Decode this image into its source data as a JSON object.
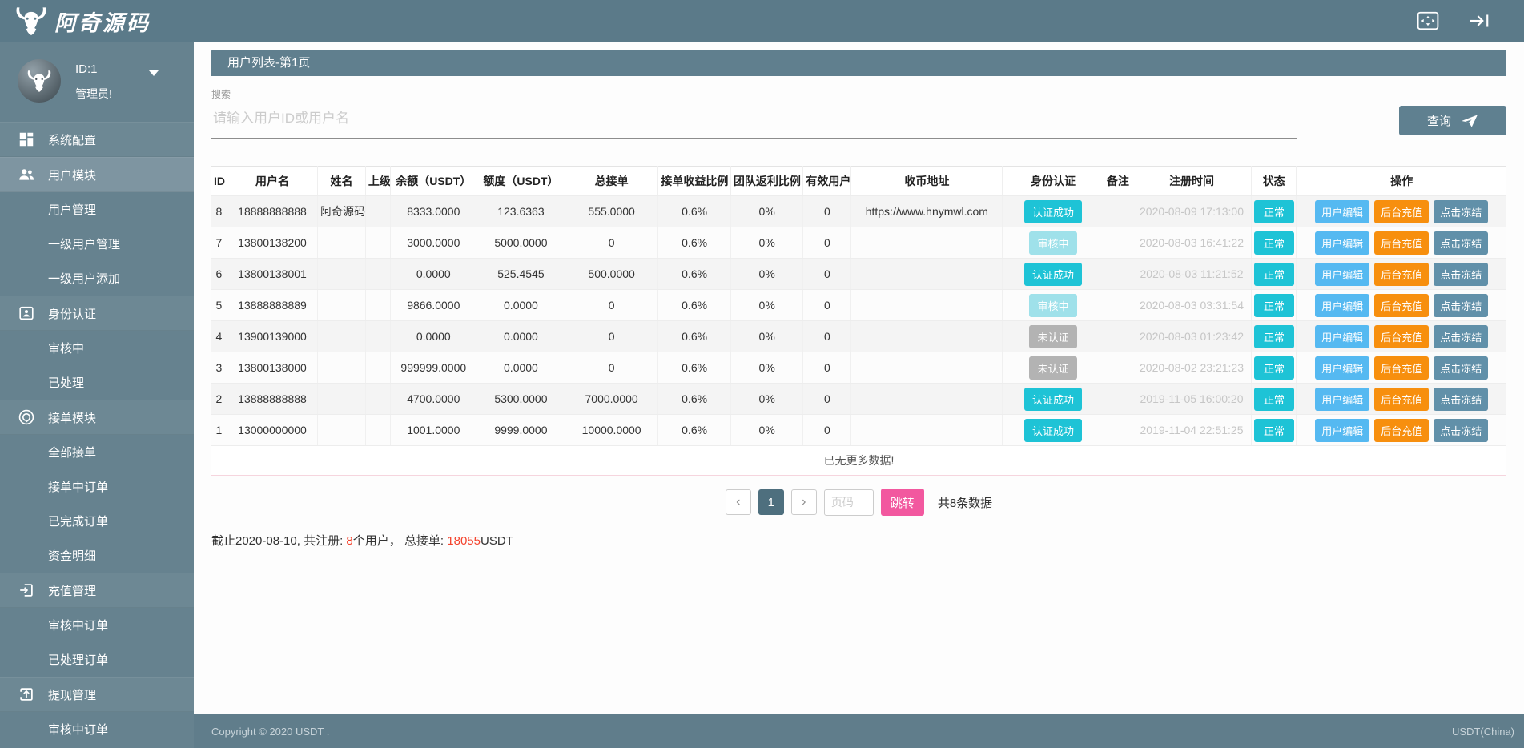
{
  "colors": {
    "topbar": "#5b7a89",
    "sidebar": "#66828f",
    "parent": "#6d8894",
    "active": "#7e95a1",
    "header": "#607f8e",
    "btn": "#5f8090",
    "footer": "#607d8b",
    "cyan": "#1ec3d6",
    "cyanpale": "#9fe1ea",
    "graybadge": "#b3b3b3",
    "blue": "#55b9f1",
    "orange": "#f78f0e",
    "freeze": "#6190a9",
    "pink": "#f2589f",
    "pageactive": "#4e6f7e",
    "red": "#f4442e",
    "pinkline": "#f6d5de"
  },
  "topbar": {
    "brand": "阿奇源码",
    "icons": [
      "bull-logo-icon",
      "fullscreen-icon",
      "logout-icon"
    ]
  },
  "sidebar": {
    "user": {
      "id_label": "ID:1",
      "role": "管理员!"
    },
    "items": [
      {
        "type": "parent",
        "key": "system-config",
        "icon": "grid-icon",
        "label": "系统配置"
      },
      {
        "type": "parent",
        "key": "user-module",
        "icon": "users-icon",
        "label": "用户模块",
        "active": true
      },
      {
        "type": "child",
        "key": "user-manage",
        "label": "用户管理"
      },
      {
        "type": "child",
        "key": "level1-user-manage",
        "label": "一级用户管理"
      },
      {
        "type": "child",
        "key": "level1-user-add",
        "label": "一级用户添加"
      },
      {
        "type": "parent",
        "key": "identity-auth",
        "icon": "idcard-icon",
        "label": "身份认证"
      },
      {
        "type": "child",
        "key": "auth-pending",
        "label": "审核中"
      },
      {
        "type": "child",
        "key": "auth-processed",
        "label": "已处理"
      },
      {
        "type": "parent",
        "key": "order-module",
        "icon": "orders-icon",
        "label": "接单模块"
      },
      {
        "type": "child",
        "key": "all-orders",
        "label": "全部接单"
      },
      {
        "type": "child",
        "key": "orders-in-progress",
        "label": "接单中订单"
      },
      {
        "type": "child",
        "key": "orders-completed",
        "label": "已完成订单"
      },
      {
        "type": "child",
        "key": "fund-details",
        "label": "资金明细"
      },
      {
        "type": "parent",
        "key": "recharge-manage",
        "icon": "recharge-icon",
        "label": "充值管理"
      },
      {
        "type": "child",
        "key": "recharge-pending",
        "label": "审核中订单"
      },
      {
        "type": "child",
        "key": "recharge-processed",
        "label": "已处理订单"
      },
      {
        "type": "parent",
        "key": "withdraw-manage",
        "icon": "withdraw-icon",
        "label": "提现管理"
      },
      {
        "type": "child",
        "key": "withdraw-pending",
        "label": "审核中订单"
      }
    ]
  },
  "panel": {
    "title": "用户列表-第1页",
    "search_label": "搜索",
    "search_placeholder": "请输入用户ID或用户名",
    "search_button": "查询"
  },
  "table": {
    "headers": [
      "ID",
      "用户名",
      "姓名",
      "上级",
      "余额（USDT）",
      "额度（USDT）",
      "总接单",
      "接单收益比例",
      "团队返利比例",
      "有效用户",
      "收币地址",
      "身份认证",
      "备注",
      "注册时间",
      "状态",
      "操作"
    ],
    "action_labels": [
      "用户编辑",
      "后台充值",
      "点击冻结"
    ],
    "no_more": "已无更多数据!",
    "rows": [
      {
        "id": "8",
        "username": "18888888888",
        "name": "阿奇源码",
        "parent": "",
        "balance": "8333.0000",
        "quota": "123.6363",
        "total_orders": "555.0000",
        "order_rate": "0.6%",
        "team_rate": "0%",
        "valid_users": "0",
        "address": "https://www.hnymwl.com",
        "auth": {
          "label": "认证成功",
          "state": "success"
        },
        "remark": "",
        "reg_time": "2020-08-09 17:13:00",
        "status": "正常"
      },
      {
        "id": "7",
        "username": "13800138200",
        "name": "",
        "parent": "",
        "balance": "3000.0000",
        "quota": "5000.0000",
        "total_orders": "0",
        "order_rate": "0.6%",
        "team_rate": "0%",
        "valid_users": "0",
        "address": "",
        "auth": {
          "label": "审核中",
          "state": "pending"
        },
        "remark": "",
        "reg_time": "2020-08-03 16:41:22",
        "status": "正常"
      },
      {
        "id": "6",
        "username": "13800138001",
        "name": "",
        "parent": "",
        "balance": "0.0000",
        "quota": "525.4545",
        "total_orders": "500.0000",
        "order_rate": "0.6%",
        "team_rate": "0%",
        "valid_users": "0",
        "address": "",
        "auth": {
          "label": "认证成功",
          "state": "success"
        },
        "remark": "",
        "reg_time": "2020-08-03 11:21:52",
        "status": "正常"
      },
      {
        "id": "5",
        "username": "13888888889",
        "name": "",
        "parent": "",
        "balance": "9866.0000",
        "quota": "0.0000",
        "total_orders": "0",
        "order_rate": "0.6%",
        "team_rate": "0%",
        "valid_users": "0",
        "address": "",
        "auth": {
          "label": "审核中",
          "state": "pending"
        },
        "remark": "",
        "reg_time": "2020-08-03 03:31:54",
        "status": "正常"
      },
      {
        "id": "4",
        "username": "13900139000",
        "name": "",
        "parent": "",
        "balance": "0.0000",
        "quota": "0.0000",
        "total_orders": "0",
        "order_rate": "0.6%",
        "team_rate": "0%",
        "valid_users": "0",
        "address": "",
        "auth": {
          "label": "未认证",
          "state": "none"
        },
        "remark": "",
        "reg_time": "2020-08-03 01:23:42",
        "status": "正常"
      },
      {
        "id": "3",
        "username": "13800138000",
        "name": "",
        "parent": "",
        "balance": "999999.0000",
        "quota": "0.0000",
        "total_orders": "0",
        "order_rate": "0.6%",
        "team_rate": "0%",
        "valid_users": "0",
        "address": "",
        "auth": {
          "label": "未认证",
          "state": "none"
        },
        "remark": "",
        "reg_time": "2020-08-02 23:21:23",
        "status": "正常"
      },
      {
        "id": "2",
        "username": "13888888888",
        "name": "",
        "parent": "",
        "balance": "4700.0000",
        "quota": "5300.0000",
        "total_orders": "7000.0000",
        "order_rate": "0.6%",
        "team_rate": "0%",
        "valid_users": "0",
        "address": "",
        "auth": {
          "label": "认证成功",
          "state": "success"
        },
        "remark": "",
        "reg_time": "2019-11-05 16:00:20",
        "status": "正常"
      },
      {
        "id": "1",
        "username": "13000000000",
        "name": "",
        "parent": "",
        "balance": "1001.0000",
        "quota": "9999.0000",
        "total_orders": "10000.0000",
        "order_rate": "0.6%",
        "team_rate": "0%",
        "valid_users": "0",
        "address": "",
        "auth": {
          "label": "认证成功",
          "state": "success"
        },
        "remark": "",
        "reg_time": "2019-11-04 22:51:25",
        "status": "正常"
      }
    ]
  },
  "pagination": {
    "prev": "‹",
    "current": "1",
    "next": "›",
    "input_placeholder": "页码",
    "jump_label": "跳转",
    "total_label": "共8条数据"
  },
  "summary": {
    "prefix": "截止2020-08-10, 共注册: ",
    "user_count": "8",
    "middle": "个用户， 总接单: ",
    "order_total": "18055",
    "suffix": "USDT"
  },
  "footer": {
    "left": "Copyright © 2020 USDT .",
    "right": "USDT(China)"
  }
}
